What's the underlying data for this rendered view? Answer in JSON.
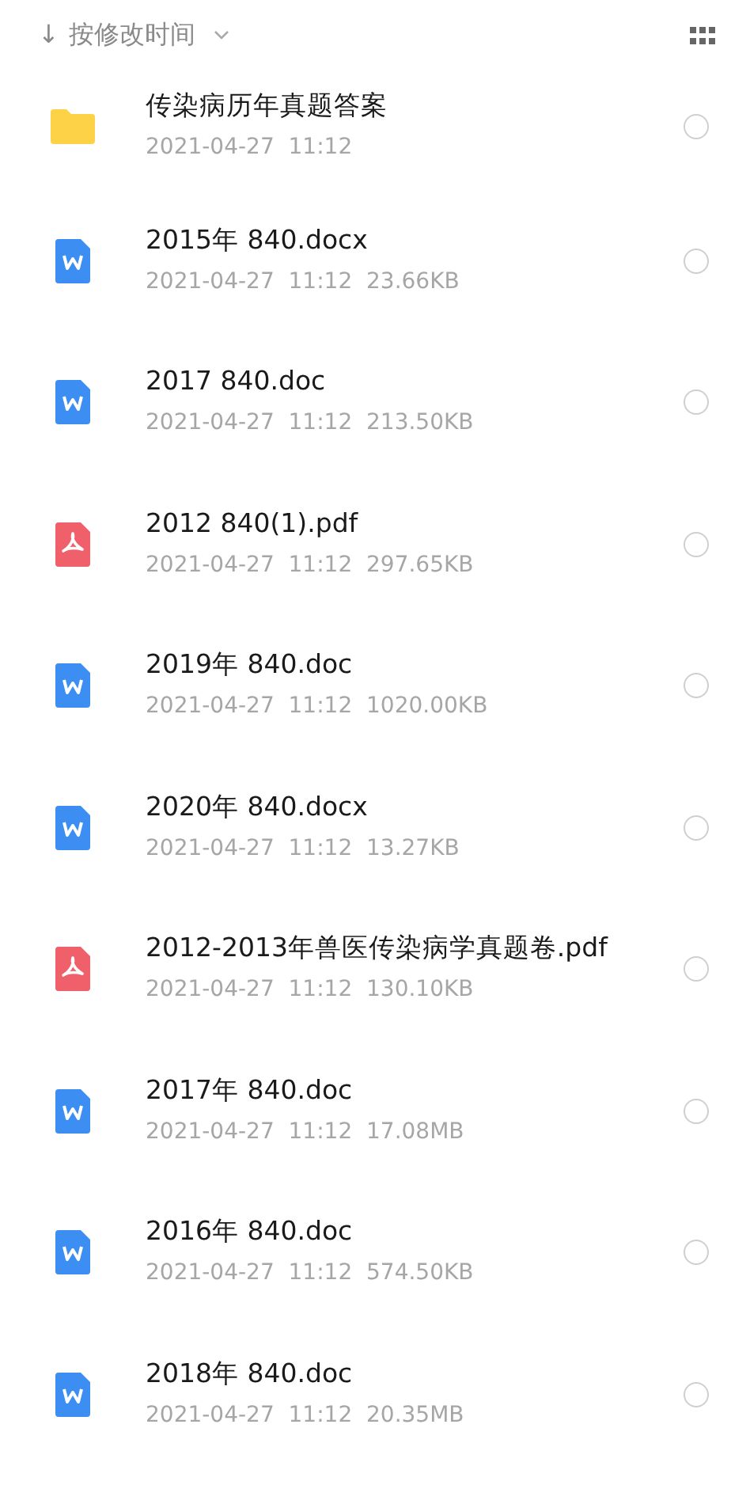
{
  "sort_bar": {
    "arrow": "↓",
    "label": "按修改时间"
  },
  "files": [
    {
      "kind": "folder",
      "name": "传染病历年真题答案",
      "date": "2021-04-27  11:12",
      "selected": false
    },
    {
      "kind": "word",
      "name": "2015年 840.docx",
      "date": "2021-04-27  11:12",
      "size": "23.66KB",
      "selected": false
    },
    {
      "kind": "word",
      "name": "2017 840.doc",
      "date": "2021-04-27  11:12",
      "size": "213.50KB",
      "selected": false
    },
    {
      "kind": "pdf",
      "name": "2012 840(1).pdf",
      "date": "2021-04-27  11:12",
      "size": "297.65KB",
      "selected": false
    },
    {
      "kind": "word",
      "name": "2019年 840.doc",
      "date": "2021-04-27  11:12",
      "size": "1020.00KB",
      "selected": false
    },
    {
      "kind": "word",
      "name": "2020年 840.docx",
      "date": "2021-04-27  11:12",
      "size": "13.27KB",
      "selected": false
    },
    {
      "kind": "pdf",
      "name": "2012-2013年兽医传染病学真题卷.pdf",
      "date": "2021-04-27  11:12",
      "size": "130.10KB",
      "selected": false
    },
    {
      "kind": "word",
      "name": "2017年 840.doc",
      "date": "2021-04-27  11:12",
      "size": "17.08MB",
      "selected": false
    },
    {
      "kind": "word",
      "name": "2016年 840.doc",
      "date": "2021-04-27  11:12",
      "size": "574.50KB",
      "selected": false
    },
    {
      "kind": "word",
      "name": "2018年 840.doc",
      "date": "2021-04-27  11:12",
      "size": "20.35MB",
      "selected": false
    }
  ]
}
